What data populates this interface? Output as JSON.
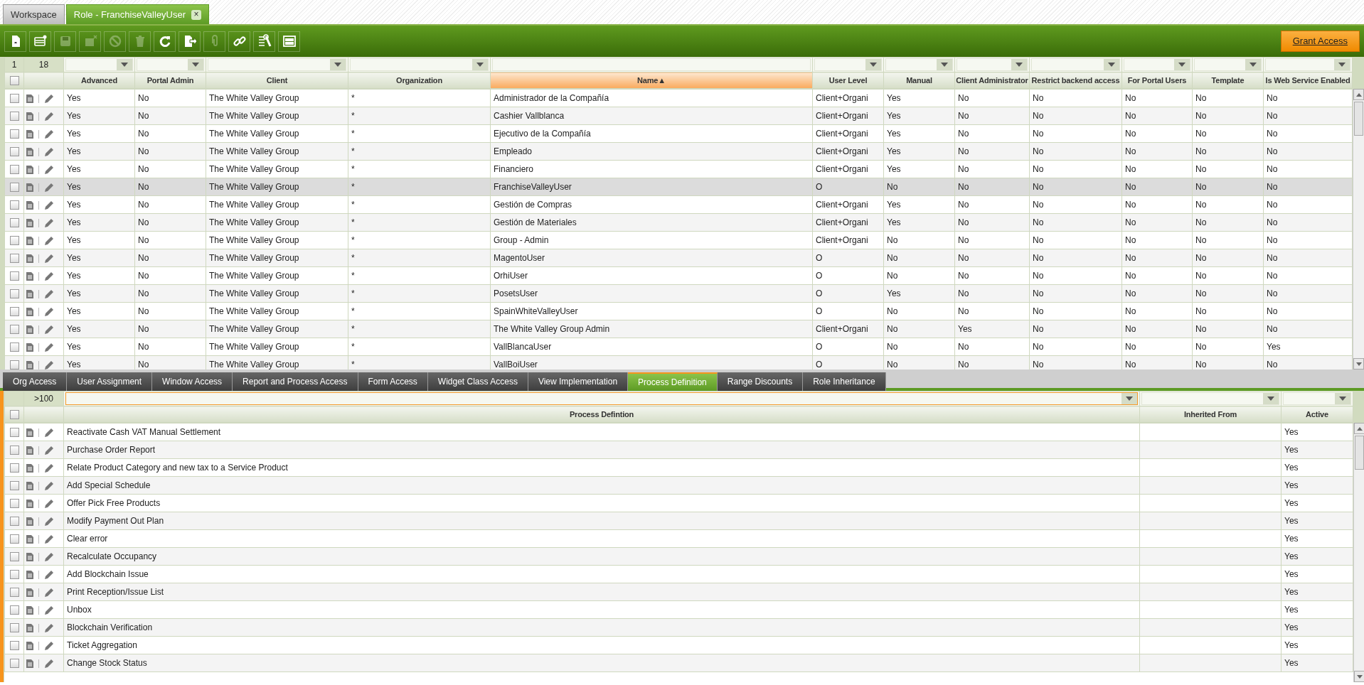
{
  "document_tabs": [
    {
      "label": "Workspace",
      "selected": false,
      "closable": false
    },
    {
      "label": "Role - FranchiseValleyUser",
      "selected": true,
      "closable": true
    }
  ],
  "close_glyph": "×",
  "toolbar": {
    "buttons": [
      {
        "kind": "new-document",
        "disabled": false
      },
      {
        "kind": "new-row",
        "disabled": false
      },
      {
        "kind": "save",
        "disabled": true
      },
      {
        "kind": "undo",
        "disabled": true
      },
      {
        "kind": "cancel",
        "disabled": true
      },
      {
        "kind": "delete",
        "disabled": true
      },
      {
        "kind": "refresh",
        "disabled": false
      },
      {
        "kind": "export",
        "disabled": false
      },
      {
        "kind": "attach",
        "disabled": true
      },
      {
        "kind": "link",
        "disabled": false
      },
      {
        "kind": "tools",
        "disabled": false
      },
      {
        "kind": "layout",
        "disabled": false
      }
    ],
    "grant_button": "Grant Access"
  },
  "top_grid": {
    "selected_count": "1",
    "total": "18",
    "select_all_checked": false,
    "columns": [
      {
        "label": "Advanced",
        "sorted": false,
        "dropdown": true
      },
      {
        "label": "Portal Admin",
        "sorted": false,
        "dropdown": true
      },
      {
        "label": "Client",
        "sorted": false,
        "dropdown": true
      },
      {
        "label": "Organization",
        "sorted": false,
        "dropdown": true
      },
      {
        "label": "Name",
        "sorted": true,
        "sort_indicator": "▲",
        "dropdown": false
      },
      {
        "label": "User Level",
        "sorted": false,
        "dropdown": true
      },
      {
        "label": "Manual",
        "sorted": false,
        "dropdown": true
      },
      {
        "label": "Client Administrator",
        "sorted": false,
        "dropdown": true
      },
      {
        "label": "Restrict backend access",
        "sorted": false,
        "dropdown": true
      },
      {
        "label": "For Portal Users",
        "sorted": false,
        "dropdown": true
      },
      {
        "label": "Template",
        "sorted": false,
        "dropdown": true
      },
      {
        "label": "Is Web Service Enabled",
        "sorted": false,
        "dropdown": true
      }
    ],
    "rows": [
      {
        "selected": false,
        "checked": false,
        "cells": [
          "Yes",
          "No",
          "The White Valley Group",
          "*",
          "Administrador de la Compañía",
          "Client+Organi",
          "Yes",
          "No",
          "No",
          "No",
          "No",
          "No"
        ]
      },
      {
        "selected": false,
        "checked": false,
        "cells": [
          "Yes",
          "No",
          "The White Valley Group",
          "*",
          "Cashier Vallblanca",
          "Client+Organi",
          "Yes",
          "No",
          "No",
          "No",
          "No",
          "No"
        ]
      },
      {
        "selected": false,
        "checked": false,
        "cells": [
          "Yes",
          "No",
          "The White Valley Group",
          "*",
          "Ejecutivo de la Compañía",
          "Client+Organi",
          "Yes",
          "No",
          "No",
          "No",
          "No",
          "No"
        ]
      },
      {
        "selected": false,
        "checked": false,
        "cells": [
          "Yes",
          "No",
          "The White Valley Group",
          "*",
          "Empleado",
          "Client+Organi",
          "Yes",
          "No",
          "No",
          "No",
          "No",
          "No"
        ]
      },
      {
        "selected": false,
        "checked": false,
        "cells": [
          "Yes",
          "No",
          "The White Valley Group",
          "*",
          "Financiero",
          "Client+Organi",
          "Yes",
          "No",
          "No",
          "No",
          "No",
          "No"
        ]
      },
      {
        "selected": true,
        "checked": false,
        "cells": [
          "Yes",
          "No",
          "The White Valley Group",
          "*",
          "FranchiseValleyUser",
          "O",
          "No",
          "No",
          "No",
          "No",
          "No",
          "No"
        ]
      },
      {
        "selected": false,
        "checked": false,
        "cells": [
          "Yes",
          "No",
          "The White Valley Group",
          "*",
          "Gestión de Compras",
          "Client+Organi",
          "Yes",
          "No",
          "No",
          "No",
          "No",
          "No"
        ]
      },
      {
        "selected": false,
        "checked": false,
        "cells": [
          "Yes",
          "No",
          "The White Valley Group",
          "*",
          "Gestión de Materiales",
          "Client+Organi",
          "Yes",
          "No",
          "No",
          "No",
          "No",
          "No"
        ]
      },
      {
        "selected": false,
        "checked": false,
        "cells": [
          "Yes",
          "No",
          "The White Valley Group",
          "*",
          "Group - Admin",
          "Client+Organi",
          "No",
          "No",
          "No",
          "No",
          "No",
          "No"
        ]
      },
      {
        "selected": false,
        "checked": false,
        "cells": [
          "Yes",
          "No",
          "The White Valley Group",
          "*",
          "MagentoUser",
          "O",
          "No",
          "No",
          "No",
          "No",
          "No",
          "No"
        ]
      },
      {
        "selected": false,
        "checked": false,
        "cells": [
          "Yes",
          "No",
          "The White Valley Group",
          "*",
          "OrhiUser",
          "O",
          "No",
          "No",
          "No",
          "No",
          "No",
          "No"
        ]
      },
      {
        "selected": false,
        "checked": false,
        "cells": [
          "Yes",
          "No",
          "The White Valley Group",
          "*",
          "PosetsUser",
          "O",
          "Yes",
          "No",
          "No",
          "No",
          "No",
          "No"
        ]
      },
      {
        "selected": false,
        "checked": false,
        "cells": [
          "Yes",
          "No",
          "The White Valley Group",
          "*",
          "SpainWhiteValleyUser",
          "O",
          "No",
          "No",
          "No",
          "No",
          "No",
          "No"
        ]
      },
      {
        "selected": false,
        "checked": false,
        "cells": [
          "Yes",
          "No",
          "The White Valley Group",
          "*",
          "The White Valley Group Admin",
          "Client+Organi",
          "No",
          "Yes",
          "No",
          "No",
          "No",
          "No"
        ]
      },
      {
        "selected": false,
        "checked": false,
        "cells": [
          "Yes",
          "No",
          "The White Valley Group",
          "*",
          "VallBlancaUser",
          "O",
          "No",
          "No",
          "No",
          "No",
          "No",
          "Yes"
        ]
      },
      {
        "selected": false,
        "checked": false,
        "cells": [
          "Yes",
          "No",
          "The White Valley Group",
          "*",
          "VallBoiUser",
          "O",
          "No",
          "No",
          "No",
          "No",
          "No",
          "No"
        ]
      }
    ]
  },
  "subtabs": [
    {
      "label": "Org Access",
      "selected": false
    },
    {
      "label": "User Assignment",
      "selected": false
    },
    {
      "label": "Window Access",
      "selected": false
    },
    {
      "label": "Report and Process Access",
      "selected": false
    },
    {
      "label": "Form Access",
      "selected": false
    },
    {
      "label": "Widget Class Access",
      "selected": false
    },
    {
      "label": "View Implementation",
      "selected": false
    },
    {
      "label": "Process Definition",
      "selected": true
    },
    {
      "label": "Range Discounts",
      "selected": false
    },
    {
      "label": "Role Inheritance",
      "selected": false
    }
  ],
  "bottom_grid": {
    "total": ">100",
    "select_all_checked": false,
    "columns": [
      {
        "label": "Process Defintion",
        "focused": true,
        "dropdown": true
      },
      {
        "label": "Inherited From",
        "focused": false,
        "dropdown": true
      },
      {
        "label": "Active",
        "focused": false,
        "dropdown": true
      }
    ],
    "rows": [
      {
        "checked": false,
        "cells": [
          "Reactivate Cash VAT Manual Settlement",
          "",
          "Yes"
        ]
      },
      {
        "checked": false,
        "cells": [
          "Purchase Order Report",
          "",
          "Yes"
        ]
      },
      {
        "checked": false,
        "cells": [
          "Relate Product Category and new tax to a Service Product",
          "",
          "Yes"
        ]
      },
      {
        "checked": false,
        "cells": [
          "Add Special Schedule",
          "",
          "Yes"
        ]
      },
      {
        "checked": false,
        "cells": [
          "Offer Pick Free Products",
          "",
          "Yes"
        ]
      },
      {
        "checked": false,
        "cells": [
          "Modify Payment Out Plan",
          "",
          "Yes"
        ]
      },
      {
        "checked": false,
        "cells": [
          "Clear error",
          "",
          "Yes"
        ]
      },
      {
        "checked": false,
        "cells": [
          "Recalculate Occupancy",
          "",
          "Yes"
        ]
      },
      {
        "checked": false,
        "cells": [
          "Add Blockchain Issue",
          "",
          "Yes"
        ]
      },
      {
        "checked": false,
        "cells": [
          "Print Reception/Issue List",
          "",
          "Yes"
        ]
      },
      {
        "checked": false,
        "cells": [
          "Unbox",
          "",
          "Yes"
        ]
      },
      {
        "checked": false,
        "cells": [
          "Blockchain Verification",
          "",
          "Yes"
        ]
      },
      {
        "checked": false,
        "cells": [
          "Ticket Aggregation",
          "",
          "Yes"
        ]
      },
      {
        "checked": false,
        "cells": [
          "Change Stock Status",
          "",
          "Yes"
        ]
      }
    ]
  }
}
